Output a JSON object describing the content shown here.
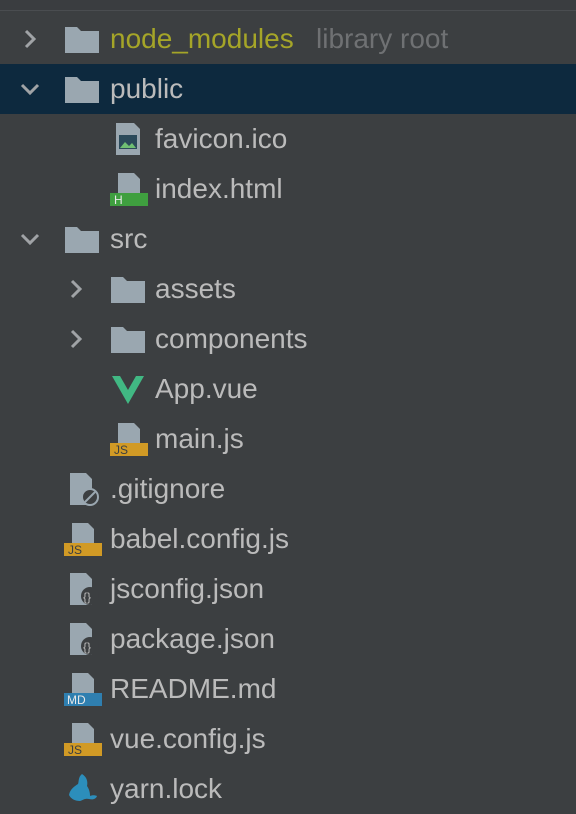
{
  "tree": {
    "node_modules": {
      "label": "node_modules",
      "hint": "library root",
      "icon": "folder-icon"
    },
    "public": {
      "label": "public",
      "icon": "folder-icon"
    },
    "favicon": {
      "label": "favicon.ico",
      "icon": "image-file-icon"
    },
    "index_html": {
      "label": "index.html",
      "icon": "html-file-icon",
      "badge": "H"
    },
    "src": {
      "label": "src",
      "icon": "folder-icon"
    },
    "assets": {
      "label": "assets",
      "icon": "folder-icon"
    },
    "components": {
      "label": "components",
      "icon": "folder-icon"
    },
    "app_vue": {
      "label": "App.vue",
      "icon": "vue-icon"
    },
    "main_js": {
      "label": "main.js",
      "icon": "js-file-icon",
      "badge": "JS"
    },
    "gitignore": {
      "label": ".gitignore",
      "icon": "ignore-file-icon"
    },
    "babel_config": {
      "label": "babel.config.js",
      "icon": "js-file-icon",
      "badge": "JS"
    },
    "jsconfig": {
      "label": "jsconfig.json",
      "icon": "json-file-icon",
      "badge": "{}"
    },
    "package_json": {
      "label": "package.json",
      "icon": "json-file-icon",
      "badge": "{}"
    },
    "readme": {
      "label": "README.md",
      "icon": "markdown-file-icon",
      "badge": "MD"
    },
    "vue_config": {
      "label": "vue.config.js",
      "icon": "js-file-icon",
      "badge": "JS"
    },
    "yarn_lock": {
      "label": "yarn.lock",
      "icon": "yarn-icon"
    }
  },
  "colors": {
    "background": "#3c3f41",
    "selection": "#0d293e",
    "text": "#bbbbbb",
    "excluded_text": "#a5a528",
    "hint_text": "#6f7173",
    "folder": "#9aa7b0",
    "js_badge": "#d19a25",
    "html_badge": "#3f9f3f",
    "md_badge": "#2f7fb0",
    "vue_green": "#41b883",
    "yarn_blue": "#2c8ebb"
  }
}
